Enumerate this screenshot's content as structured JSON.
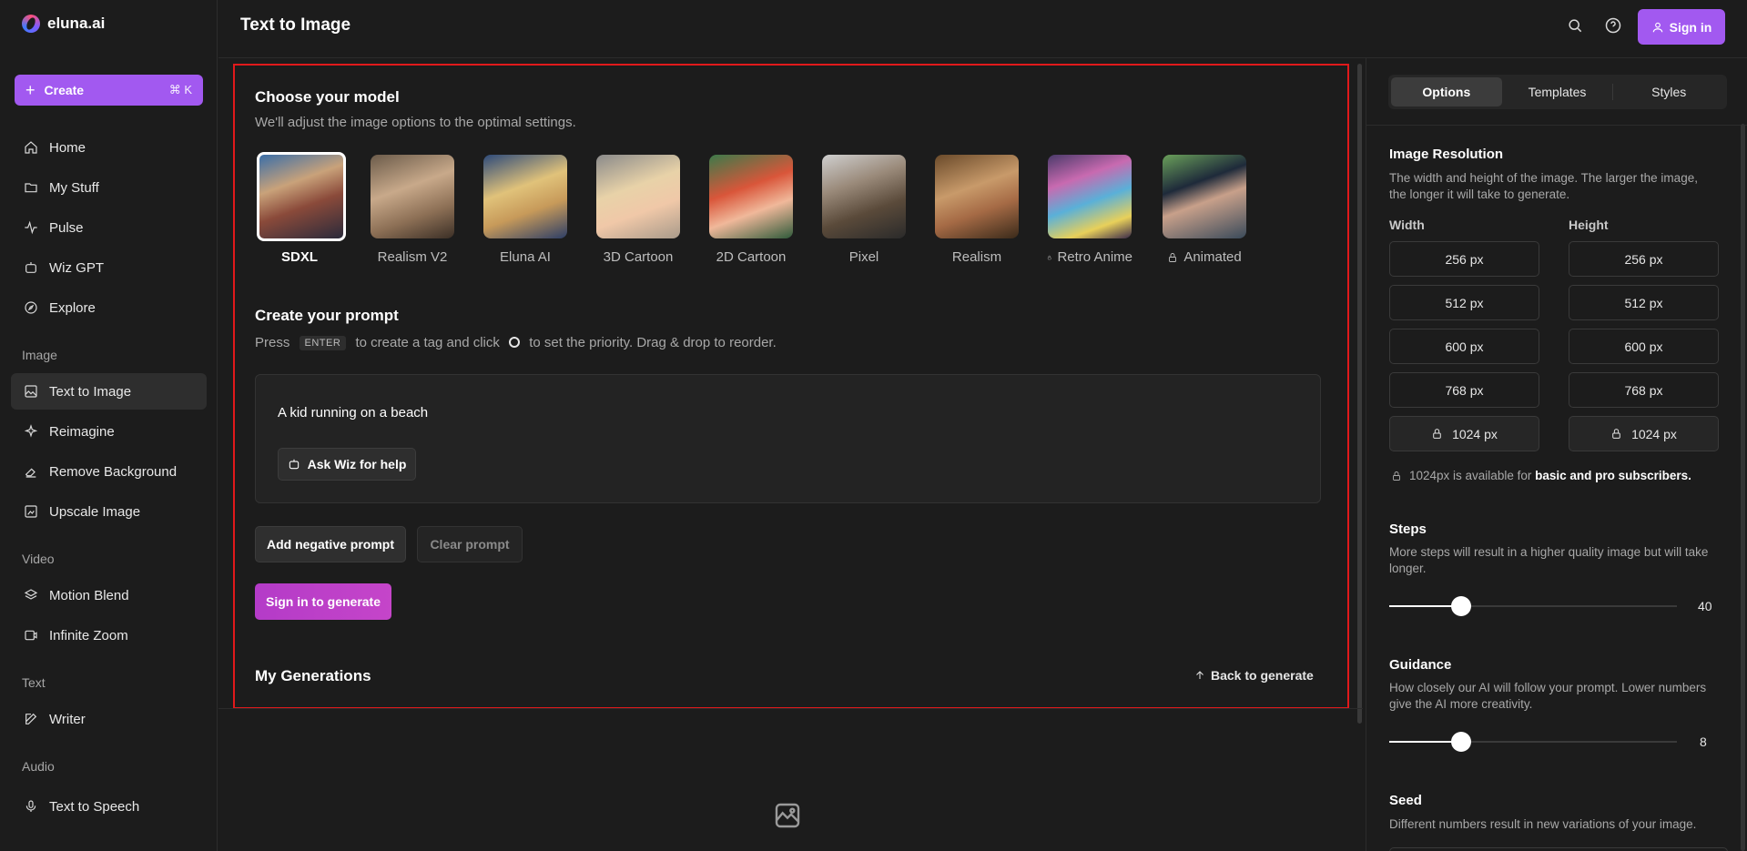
{
  "app": {
    "name": "eluna.ai"
  },
  "sidebar": {
    "create": {
      "label": "Create",
      "shortcut": "⌘ K"
    },
    "main_items": [
      {
        "label": "Home",
        "icon": "home-icon"
      },
      {
        "label": "My Stuff",
        "icon": "folder-icon"
      },
      {
        "label": "Pulse",
        "icon": "pulse-icon"
      },
      {
        "label": "Wiz GPT",
        "icon": "bot-icon"
      },
      {
        "label": "Explore",
        "icon": "compass-icon"
      }
    ],
    "sections": {
      "image": "Image",
      "video": "Video",
      "text": "Text",
      "audio": "Audio"
    },
    "image_items": [
      {
        "label": "Text to Image",
        "icon": "image-icon",
        "active": true
      },
      {
        "label": "Reimagine",
        "icon": "sparkle-icon"
      },
      {
        "label": "Remove Background",
        "icon": "eraser-icon"
      },
      {
        "label": "Upscale Image",
        "icon": "upscale-icon"
      }
    ],
    "video_items": [
      {
        "label": "Motion Blend",
        "icon": "layers-icon"
      },
      {
        "label": "Infinite Zoom",
        "icon": "zoom-video-icon"
      }
    ],
    "text_items": [
      {
        "label": "Writer",
        "icon": "pen-icon"
      }
    ],
    "audio_items": [
      {
        "label": "Text to Speech",
        "icon": "microphone-icon"
      }
    ]
  },
  "header": {
    "title": "Text to Image",
    "sign_in": "Sign in"
  },
  "model_section": {
    "title": "Choose your model",
    "subtitle": "We'll adjust the image options to the optimal settings.",
    "models": [
      {
        "label": "SDXL",
        "selected": true,
        "locked": false
      },
      {
        "label": "Realism V2",
        "locked": false
      },
      {
        "label": "Eluna AI",
        "locked": false
      },
      {
        "label": "3D Cartoon",
        "locked": false
      },
      {
        "label": "2D Cartoon",
        "locked": false
      },
      {
        "label": "Pixel",
        "locked": false
      },
      {
        "label": "Realism",
        "locked": false
      },
      {
        "label": "Retro Anime",
        "locked": true
      },
      {
        "label": "Animated",
        "locked": true
      }
    ]
  },
  "prompt_section": {
    "title": "Create your prompt",
    "hint_press": "Press",
    "hint_key": "ENTER",
    "hint_middle": "to create a tag and click",
    "hint_end": "to set the priority. Drag & drop to reorder.",
    "prompt_value": "A kid running on a beach",
    "ask_wiz": "Ask Wiz for help",
    "add_negative": "Add negative prompt",
    "clear_prompt": "Clear prompt",
    "generate": "Sign in to generate"
  },
  "generations": {
    "title": "My Generations",
    "back": "Back to generate"
  },
  "right_panel": {
    "tabs": [
      "Options",
      "Templates",
      "Styles"
    ],
    "active_tab": "Options",
    "resolution": {
      "title": "Image Resolution",
      "description": "The width and height of the image. The larger the image, the longer it will take to generate.",
      "width_label": "Width",
      "height_label": "Height",
      "widths": [
        "256 px",
        "512 px",
        "600 px",
        "768 px",
        "1024 px"
      ],
      "heights": [
        "256 px",
        "512 px",
        "600 px",
        "768 px",
        "1024 px"
      ],
      "availability_prefix": "1024px is available for",
      "availability_emphasis": "basic and pro subscribers."
    },
    "steps": {
      "title": "Steps",
      "description": "More steps will result in a higher quality image but will take longer.",
      "value": "40",
      "fraction": 0.25
    },
    "guidance": {
      "title": "Guidance",
      "description": "How closely our AI will follow your prompt. Lower numbers give the AI more creativity.",
      "value": "8",
      "fraction": 0.25
    },
    "seed": {
      "title": "Seed",
      "description": "Different numbers result in new variations of your image."
    }
  },
  "colors": {
    "accent": "#a259f0",
    "generate": "#b43bc8",
    "frame": "#e0191b"
  }
}
